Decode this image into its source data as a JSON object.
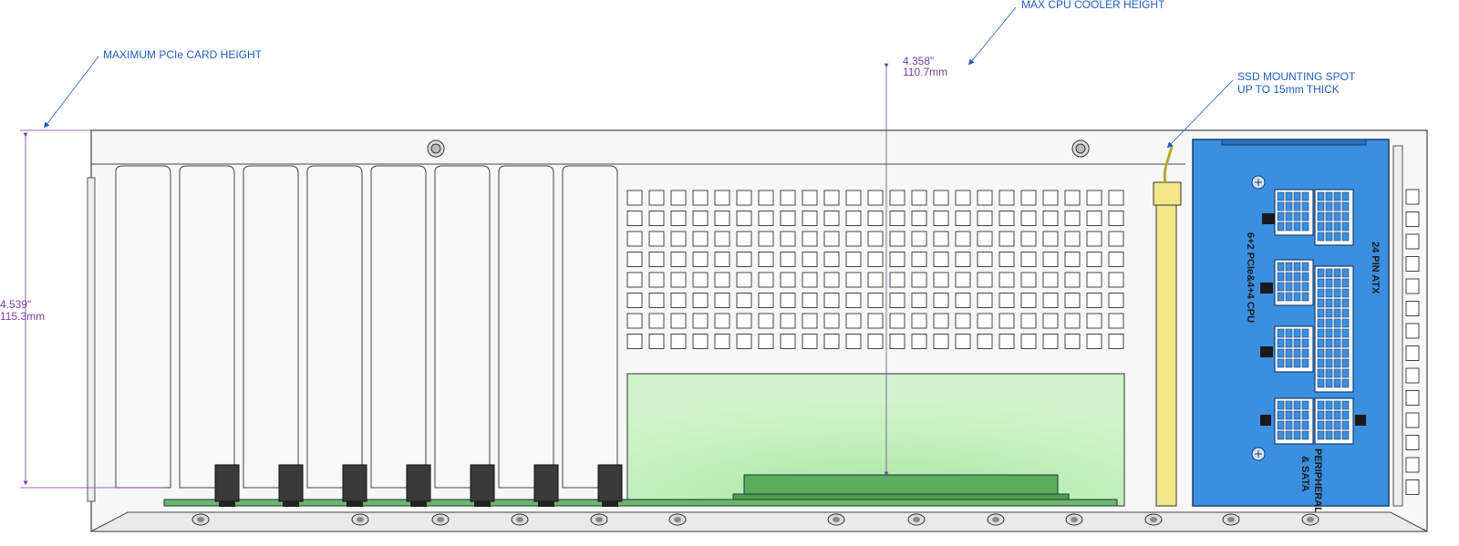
{
  "callouts": {
    "pcie_height": "MAXIMUM PCIe CARD HEIGHT",
    "cpu_cooler": "MAX CPU COOLER HEIGHT",
    "ssd_line1": "SSD MOUNTING SPOT",
    "ssd_line2": "UP TO 15mm THICK"
  },
  "dimensions": {
    "pcie_in": "4.539\"",
    "pcie_mm": "115.3mm",
    "cpu_in": "4.358\"",
    "cpu_mm": "110.7mm"
  },
  "psu_labels": {
    "atx": "24 PIN ATX",
    "pcie_cpu": "6+2 PCIe&4+4 CPU",
    "periph1": "PERIPHERAL",
    "periph2": "& SATA"
  },
  "colors": {
    "callout": "#1f5fbf",
    "dimension": "#7a3fa0",
    "psu": "#3a8fe0",
    "board": "#c8f0c0",
    "ssd": "#f2e88a"
  },
  "icons": {
    "slot_screw": "screw-icon",
    "psu_screw": "phillips-screw-icon",
    "vent": "vent-hole-icon"
  }
}
